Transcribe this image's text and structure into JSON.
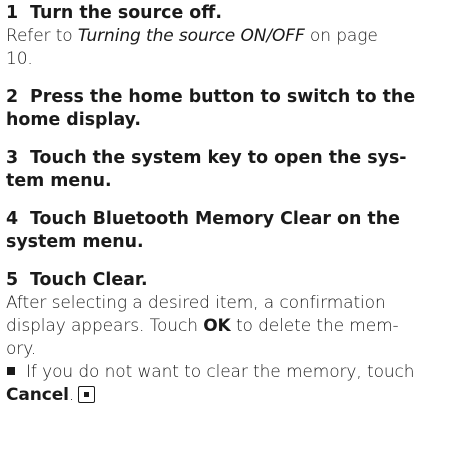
{
  "steps": [
    {
      "number": "1",
      "title": "Turn the source off.",
      "body_pre": "Refer to ",
      "body_link": "Turning the source ON/OFF",
      "body_post1": " on page",
      "body_post2": "10."
    },
    {
      "number": "2",
      "title_line1": "Press the home button to switch to the",
      "title_line2": "home display."
    },
    {
      "number": "3",
      "title_line1": "Touch the system key to open the sys-",
      "title_line2": "tem menu."
    },
    {
      "number": "4",
      "title_line1": "Touch Bluetooth Memory Clear on the",
      "title_line2": "system menu."
    },
    {
      "number": "5",
      "title": "Touch Clear.",
      "body_line1": "After selecting a desired item, a confirmation",
      "body_line2_pre": "display appears. Touch ",
      "body_line2_bold": "OK",
      "body_line2_post": " to delete the mem-",
      "body_line3": "ory."
    }
  ],
  "note": {
    "line1": "If you do not want to clear the memory, touch",
    "line2_bold": "Cancel",
    "line2_post": "."
  },
  "icons": {
    "bullet": "square-bullet-icon",
    "end": "end-of-section-icon"
  }
}
